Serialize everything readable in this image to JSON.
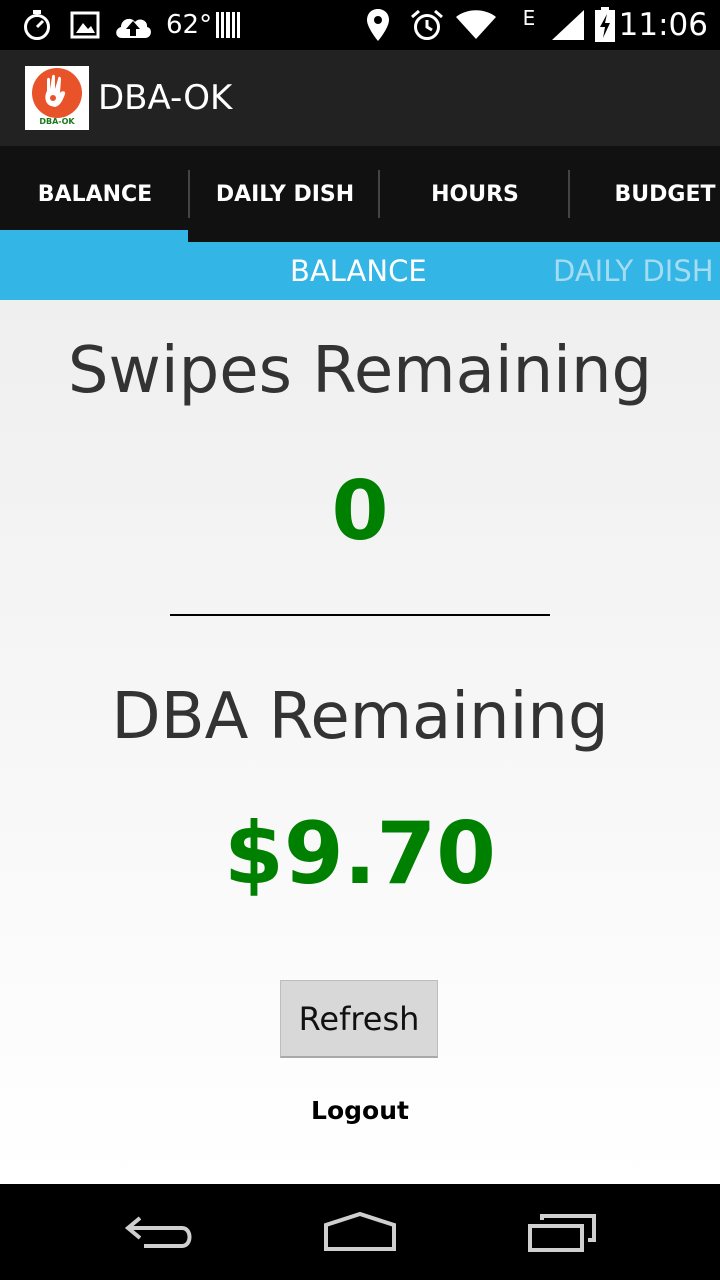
{
  "status_bar": {
    "temperature": "62°",
    "time": "11:06",
    "network_type": "E",
    "icons": [
      "stopwatch-icon",
      "image-icon",
      "cloud-upload-icon",
      "barcode-icon",
      "location-pin-icon",
      "alarm-icon",
      "wifi-icon",
      "signal-icon",
      "battery-charging-icon"
    ]
  },
  "action_bar": {
    "app_icon_label": "DBA-OK",
    "title": "DBA-OK"
  },
  "tabs": [
    {
      "label": "BALANCE"
    },
    {
      "label": "DAILY DISH"
    },
    {
      "label": "HOURS"
    },
    {
      "label": "BUDGET"
    }
  ],
  "pager": {
    "current": "BALANCE",
    "next": "DAILY DISH"
  },
  "balance": {
    "swipes_heading": "Swipes Remaining",
    "swipes_value": "0",
    "dba_heading": "DBA Remaining",
    "dba_value": "$9.70",
    "refresh_label": "Refresh",
    "logout_label": "Logout"
  },
  "nav_bar": {
    "icons": [
      "back-icon",
      "home-icon",
      "recent-apps-icon"
    ]
  },
  "colors": {
    "accent": "#33b5e5",
    "value_green": "#008000",
    "app_icon_orange": "#e8532a"
  }
}
